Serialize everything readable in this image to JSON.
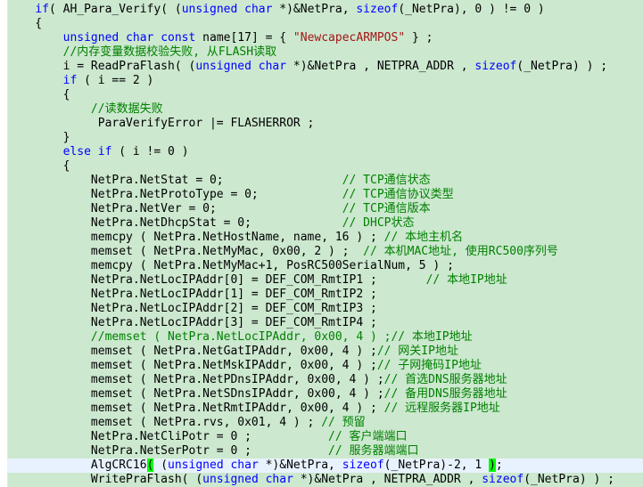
{
  "editor": {
    "colors": {
      "background": "#cce8cf",
      "keyword": "#0000ff",
      "string": "#a31515",
      "comment": "#008000",
      "current_line": "#e8f2fe",
      "brace_match": "#00ff00"
    },
    "current_line_index": 32,
    "lines": [
      [
        [
          "plain",
          "    "
        ],
        [
          "kw",
          "if"
        ],
        [
          "plain",
          "( AH_Para_Verify( ("
        ],
        [
          "kw",
          "unsigned char"
        ],
        [
          "plain",
          " *)&NetPra, "
        ],
        [
          "kw",
          "sizeof"
        ],
        [
          "plain",
          "(_NetPra), 0 ) != 0 )"
        ]
      ],
      [
        [
          "plain",
          "    {"
        ]
      ],
      [
        [
          "plain",
          "        "
        ],
        [
          "kw",
          "unsigned char const"
        ],
        [
          "plain",
          " name[17] = { "
        ],
        [
          "str",
          "\"NewcapecARMPOS\""
        ],
        [
          "plain",
          " } ;"
        ]
      ],
      [
        [
          "plain",
          "        "
        ],
        [
          "cmt",
          "//内存变量数据校验失败, 从FLASH读取"
        ]
      ],
      [
        [
          "plain",
          "        i = ReadPraFlash( ("
        ],
        [
          "kw",
          "unsigned char"
        ],
        [
          "plain",
          " *)&NetPra , NETPRA_ADDR , "
        ],
        [
          "kw",
          "sizeof"
        ],
        [
          "plain",
          "(_NetPra) ) ;"
        ]
      ],
      [
        [
          "plain",
          "        "
        ],
        [
          "kw",
          "if"
        ],
        [
          "plain",
          " ( i == 2 )"
        ]
      ],
      [
        [
          "plain",
          "        {"
        ]
      ],
      [
        [
          "plain",
          "            "
        ],
        [
          "cmt",
          "//读数据失败"
        ]
      ],
      [
        [
          "plain",
          "             ParaVerifyError |= FLASHERROR ;"
        ]
      ],
      [
        [
          "plain",
          "        }"
        ]
      ],
      [
        [
          "plain",
          "        "
        ],
        [
          "kw",
          "else if"
        ],
        [
          "plain",
          " ( i != 0 )"
        ]
      ],
      [
        [
          "plain",
          "        {"
        ]
      ],
      [
        [
          "plain",
          "            NetPra.NetStat = 0;                 "
        ],
        [
          "cmt",
          "// TCP通信状态"
        ]
      ],
      [
        [
          "plain",
          "            NetPra.NetProtoType = 0;            "
        ],
        [
          "cmt",
          "// TCP通信协议类型"
        ]
      ],
      [
        [
          "plain",
          "            NetPra.NetVer = 0;                  "
        ],
        [
          "cmt",
          "// TCP通信版本"
        ]
      ],
      [
        [
          "plain",
          "            NetPra.NetDhcpStat = 0;             "
        ],
        [
          "cmt",
          "// DHCP状态"
        ]
      ],
      [
        [
          "plain",
          "            memcpy ( NetPra.NetHostName, name, 16 ) ; "
        ],
        [
          "cmt",
          "// 本地主机名"
        ]
      ],
      [
        [
          "plain",
          "            memset ( NetPra.NetMyMac, 0x00, 2 ) ;  "
        ],
        [
          "cmt",
          "// 本机MAC地址, 使用RC500序列号"
        ]
      ],
      [
        [
          "plain",
          "            memcpy ( NetPra.NetMyMac+1, PosRC500SerialNum, 5 ) ;"
        ]
      ],
      [
        [
          "plain",
          "            NetPra.NetLocIPAddr[0] = DEF_COM_RmtIP1 ;       "
        ],
        [
          "cmt",
          "// 本地IP地址"
        ]
      ],
      [
        [
          "plain",
          "            NetPra.NetLocIPAddr[1] = DEF_COM_RmtIP2 ;"
        ]
      ],
      [
        [
          "plain",
          "            NetPra.NetLocIPAddr[2] = DEF_COM_RmtIP3 ;"
        ]
      ],
      [
        [
          "plain",
          "            NetPra.NetLocIPAddr[3] = DEF_COM_RmtIP4 ;"
        ]
      ],
      [
        [
          "plain",
          "            "
        ],
        [
          "cmt",
          "//memset ( NetPra.NetLocIPAddr, 0x00, 4 ) ;// 本地IP地址"
        ]
      ],
      [
        [
          "plain",
          "            memset ( NetPra.NetGatIPAddr, 0x00, 4 ) ;"
        ],
        [
          "cmt",
          "// 网关IP地址"
        ]
      ],
      [
        [
          "plain",
          "            memset ( NetPra.NetMskIPAddr, 0x00, 4 ) ;"
        ],
        [
          "cmt",
          "// 子网掩码IP地址"
        ]
      ],
      [
        [
          "plain",
          "            memset ( NetPra.NetPDnsIPAddr, 0x00, 4 ) ;"
        ],
        [
          "cmt",
          "// 首选DNS服务器地址"
        ]
      ],
      [
        [
          "plain",
          "            memset ( NetPra.NetSDnsIPAddr, 0x00, 4 ) ;"
        ],
        [
          "cmt",
          "// 备用DNS服务器地址"
        ]
      ],
      [
        [
          "plain",
          "            memset ( NetPra.NetRmtIPAddr, 0x00, 4 ) ; "
        ],
        [
          "cmt",
          "// 远程服务器IP地址"
        ]
      ],
      [
        [
          "plain",
          "            memset ( NetPra.rvs, 0x01, 4 ) ; "
        ],
        [
          "cmt",
          "// 预留"
        ]
      ],
      [
        [
          "plain",
          "            NetPra.NetCliPotr = 0 ;           "
        ],
        [
          "cmt",
          "// 客户端端口"
        ]
      ],
      [
        [
          "plain",
          "            NetPra.NetSerPotr = 0 ;           "
        ],
        [
          "cmt",
          "// 服务器端端口"
        ]
      ],
      [
        [
          "plain",
          "            AlgCRC16"
        ],
        [
          "brace",
          "("
        ],
        [
          "plain",
          " ("
        ],
        [
          "kw",
          "unsigned char"
        ],
        [
          "plain",
          " *)&NetPra, "
        ],
        [
          "kw",
          "sizeof"
        ],
        [
          "plain",
          "(_NetPra)-2, 1 "
        ],
        [
          "brace",
          ")"
        ],
        [
          "plain",
          ";"
        ]
      ],
      [
        [
          "plain",
          "            WritePraFlash( ("
        ],
        [
          "kw",
          "unsigned char"
        ],
        [
          "plain",
          " *)&NetPra , NETPRA_ADDR , "
        ],
        [
          "kw",
          "sizeof"
        ],
        [
          "plain",
          "(_NetPra) ) ;"
        ]
      ]
    ]
  }
}
